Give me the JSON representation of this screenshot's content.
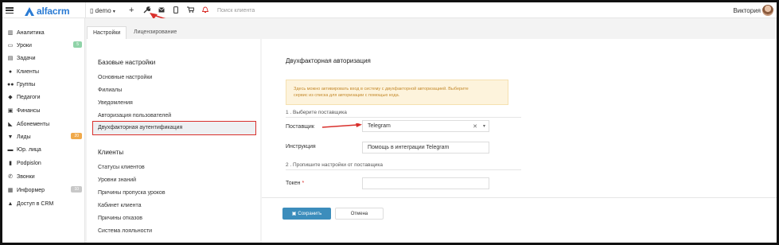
{
  "topbar": {
    "logo_text": "alfacrm",
    "branch": "demo",
    "branch_caret": "▾",
    "add_icon": "+",
    "tools_icon": "wrench-icon",
    "search_placeholder": "Поиск клиента",
    "user_name": "Виктория"
  },
  "sidebar": {
    "items": [
      {
        "label": "Аналитика",
        "icon": "chart-icon"
      },
      {
        "label": "Уроки",
        "icon": "calendar-icon",
        "badge": "5"
      },
      {
        "label": "Задачи",
        "icon": "tasks-icon"
      },
      {
        "label": "Клиенты",
        "icon": "user-icon"
      },
      {
        "label": "Группы",
        "icon": "users-icon"
      },
      {
        "label": "Педагоги",
        "icon": "graduation-icon"
      },
      {
        "label": "Финансы",
        "icon": "money-icon"
      },
      {
        "label": "Абонементы",
        "icon": "tag-icon"
      },
      {
        "label": "Лиды",
        "icon": "funnel-icon",
        "badge": "20"
      },
      {
        "label": "Юр. лица",
        "icon": "briefcase-icon"
      },
      {
        "label": "Podpislon",
        "icon": "doc-icon"
      },
      {
        "label": "Звонки",
        "icon": "phone-icon"
      },
      {
        "label": "Информер",
        "icon": "inbox-icon",
        "badge": "10"
      },
      {
        "label": "Доступ в CRM",
        "icon": "lock-icon"
      }
    ]
  },
  "tabs": [
    {
      "label": "Настройки",
      "active": true
    },
    {
      "label": "Лицензирование",
      "active": false
    }
  ],
  "settings_menu": {
    "base_title": "Базовые настройки",
    "base_items": [
      "Основные настройки",
      "Филиалы",
      "Уведомления",
      "Авторизация пользователей",
      "Двухфакторная аутентификация"
    ],
    "clients_title": "Клиенты",
    "client_items": [
      "Статусы клиентов",
      "Уровни знаний",
      "Причины пропуска уроков",
      "Кабинет клиента",
      "Причины отказов",
      "Система лояльности"
    ]
  },
  "form": {
    "title": "Двухфакторная авторизация",
    "alert_line1": "Здесь можно активировать вход в систему с двухфакторной авторизацией. Выберите",
    "alert_line2": "сервис из списка для авторизации с помощью кода.",
    "step1": "1 . Выберите поставщика",
    "provider_label": "Поставщик",
    "provider_value": "Telegram",
    "instruction_label": "Инструкция",
    "instruction_value": "Помощь в интеграции Telegram",
    "step2": "2 . Пропишите настройки от поставщика",
    "token_label": "Токен",
    "token_required": "*",
    "save_label": "Сохранить",
    "cancel_label": "Отмена"
  },
  "colors": {
    "accent": "#3c8dbc",
    "annotation": "#d9302c",
    "badge_green": "#8fd3a8",
    "badge_orange": "#f0a94a",
    "badge_gray": "#c8c8c8"
  }
}
